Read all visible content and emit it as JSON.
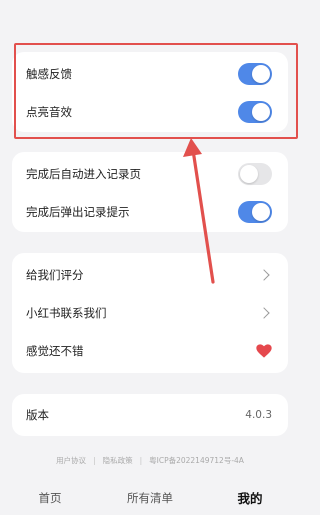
{
  "settings_card": {
    "haptics_label": "触感反馈",
    "haptics_on": true,
    "bright_sound_label": "点亮音效",
    "bright_sound_on": true
  },
  "record_card": {
    "auto_enter_label": "完成后自动进入记录页",
    "auto_enter_on": false,
    "popup_label": "完成后弹出记录提示",
    "popup_on": true
  },
  "links_card": {
    "rate_label": "给我们评分",
    "xiaohongshu_label": "小红书联系我们",
    "like_label": "感觉还不错"
  },
  "version_card": {
    "label": "版本",
    "value": "4.0.3"
  },
  "footer": {
    "user_agreement": "用户协议",
    "separator": "|",
    "privacy_policy": "隐私政策",
    "icp": "粤ICP备2022149712号-4A"
  },
  "tabbar": {
    "home": "首页",
    "all_lists": "所有清单",
    "mine": "我的"
  },
  "colors": {
    "toggle_on": "#4f88e8",
    "toggle_off": "#e6e6e8",
    "annotation_red": "#e2504d",
    "heart": "#e5484d"
  },
  "icons": {
    "chevron": "chevron-right-icon",
    "heart": "heart-icon"
  }
}
